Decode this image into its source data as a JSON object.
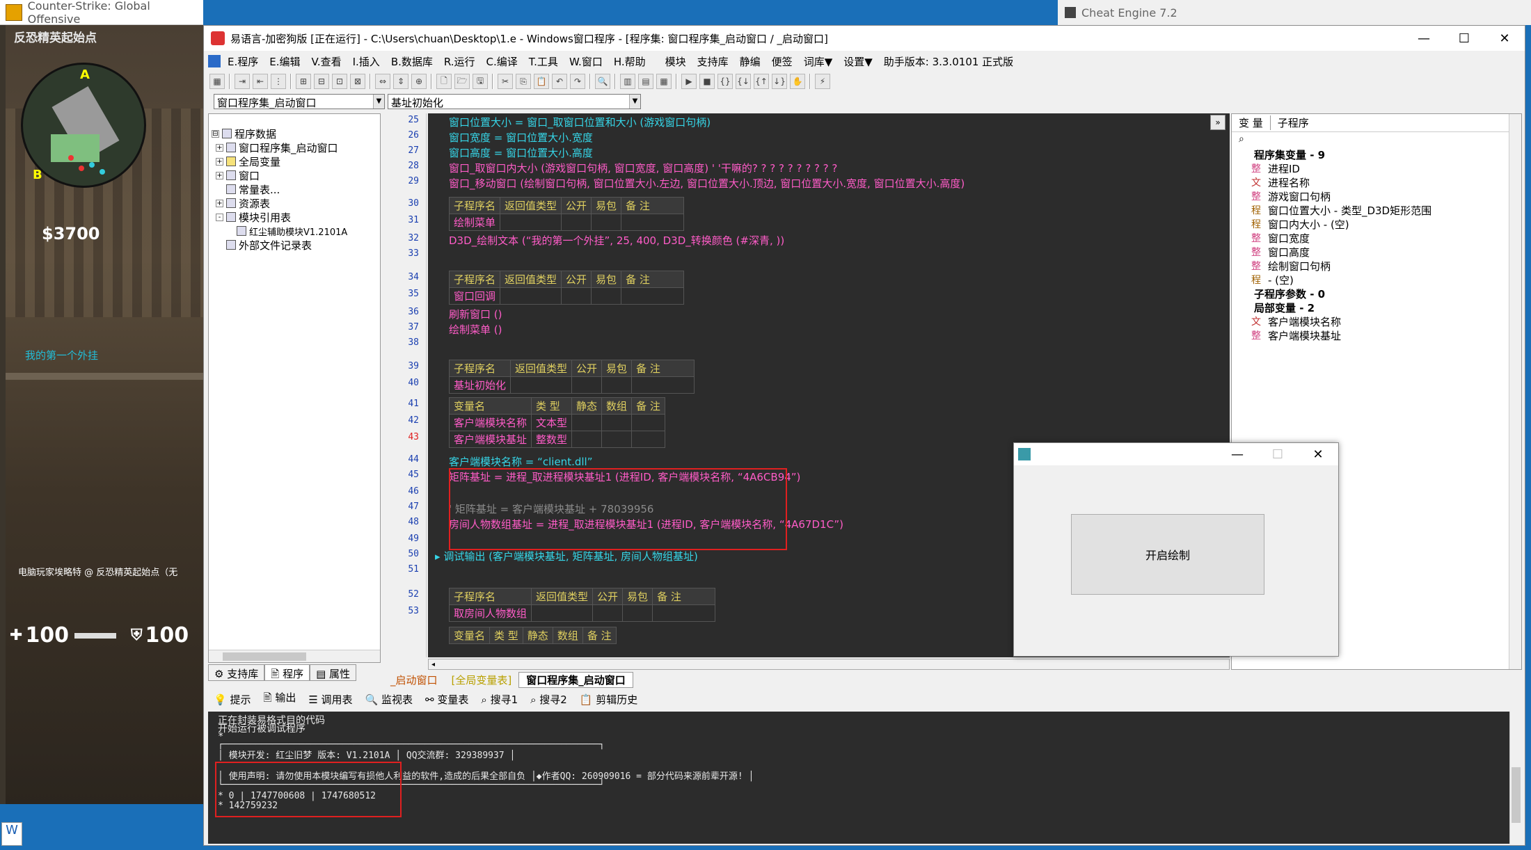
{
  "game": {
    "title": "Counter-Strike: Global Offensive",
    "location": "反恐精英起始点",
    "money": "$3700",
    "radar_label_a": "A",
    "radar_label_b": "B",
    "overlay_text": "我的第一个外挂",
    "chat": "电脑玩家埃略特 @ 反恐精英起始点（无",
    "health": "100",
    "armor": "100"
  },
  "cheat_engine": {
    "title": "Cheat Engine 7.2"
  },
  "ide": {
    "title": "易语言-加密狗版 [正在运行] - C:\\Users\\chuan\\Desktop\\1.e - Windows窗口程序 - [程序集: 窗口程序集_启动窗口 / _启动窗口]",
    "window_controls": {
      "min": "—",
      "max": "☐",
      "close": "✕"
    },
    "menu": [
      "E.程序",
      "E.编辑",
      "V.查看",
      "I.插入",
      "B.数据库",
      "R.运行",
      "C.编译",
      "T.工具",
      "W.窗口",
      "H.帮助",
      "模块",
      "支持库",
      "静编",
      "便签",
      "词库▼",
      "设置▼",
      "助手版本: 3.3.0101 正式版"
    ],
    "combo_left": "窗口程序集_启动窗口",
    "combo_right": "基址初始化",
    "tree": [
      {
        "label": "程序数据",
        "indent": 0,
        "pm": "⊟"
      },
      {
        "label": "窗口程序集_启动窗口",
        "indent": 1,
        "pm": "+"
      },
      {
        "label": "全局变量",
        "indent": 1,
        "pm": "+"
      },
      {
        "label": "窗口",
        "indent": 1,
        "pm": "+"
      },
      {
        "label": "常量表...",
        "indent": 1,
        "pm": ""
      },
      {
        "label": "资源表",
        "indent": 1,
        "pm": "+"
      },
      {
        "label": "模块引用表",
        "indent": 1,
        "pm": "-"
      },
      {
        "label": "红尘辅助模块V1.2101A",
        "indent": 2,
        "pm": ""
      },
      {
        "label": "外部文件记录表",
        "indent": 1,
        "pm": ""
      }
    ],
    "left_tabs": [
      "支持库",
      "程序",
      "属性"
    ],
    "line_numbers": [
      "25",
      "26",
      "27",
      "28",
      "29",
      "30",
      "31",
      "32",
      "33",
      "34",
      "35",
      "36",
      "37",
      "38",
      "39",
      "40",
      "41",
      "42",
      "43",
      "44",
      "45",
      "46",
      "47",
      "48",
      "49",
      "50",
      "51",
      "52",
      "53"
    ],
    "code": {
      "l25": "窗口位置大小 = 窗口_取窗口位置和大小 (游戏窗口句柄)",
      "l26": "窗口宽度 = 窗口位置大小.宽度",
      "l27": "窗口高度 = 窗口位置大小.高度",
      "l28": "窗口_取窗口内大小 (游戏窗口句柄, 窗口宽度, 窗口高度) ' '干嘛的? ? ? ? ? ? ? ? ? ?",
      "l29": "窗口_移动窗口 (绘制窗口句柄, 窗口位置大小.左边, 窗口位置大小.顶边, 窗口位置大小.宽度, 窗口位置大小.高度)",
      "t1_header": [
        "子程序名",
        "返回值类型",
        "公开",
        "易包",
        "备 注"
      ],
      "t1_row": [
        "绘制菜单",
        "",
        "",
        "",
        ""
      ],
      "l32": "D3D_绘制文本 (“我的第一个外挂”, 25, 400, D3D_转换颜色 (#深青, ))",
      "t2_header": [
        "子程序名",
        "返回值类型",
        "公开",
        "易包",
        "备 注"
      ],
      "t2_row": [
        "窗口回调",
        "",
        "",
        "",
        ""
      ],
      "l36": "刷新窗口 ()",
      "l37": "绘制菜单 ()",
      "t3_header": [
        "子程序名",
        "返回值类型",
        "公开",
        "易包",
        "备 注"
      ],
      "t3_row": [
        "基址初始化",
        "",
        "",
        "",
        ""
      ],
      "t4_header": [
        "变量名",
        "类 型",
        "静态",
        "数组",
        "备 注"
      ],
      "t4_rows": [
        [
          "客户端模块名称",
          "文本型",
          "",
          "",
          ""
        ],
        [
          "客户端模块基址",
          "整数型",
          "",
          "",
          ""
        ]
      ],
      "l44": "客户端模块名称 = “client.dll”",
      "l45": "矩阵基址 = 进程_取进程模块基址1 (进程ID, 客户端模块名称, “4A6CB94”)",
      "l47": "' 矩阵基址 = 客户端模块基址 + 78039956",
      "l48": "房间人物数组基址 = 进程_取进程模块基址1 (进程ID, 客户端模块名称, “4A67D1C”)",
      "l50": "调试输出 (客户端模块基址, 矩阵基址, 房间人物组基址)",
      "t5_header": [
        "子程序名",
        "返回值类型",
        "公开",
        "易包",
        "备 注"
      ],
      "t5_row": [
        "取房间人物数组",
        "",
        "",
        "",
        ""
      ],
      "t6_header": [
        "变量名",
        "类 型",
        "静态",
        "数组",
        "备 注"
      ]
    },
    "code_tabs": [
      "_启动窗口",
      "[全局变量表]",
      "窗口程序集_启动窗口"
    ],
    "right_tabs": [
      "变 量",
      "子程序"
    ],
    "right_tree": [
      {
        "tag": "",
        "label": "程序集变量 - 9",
        "bold": true,
        "indent": 0
      },
      {
        "tag": "整",
        "label": "进程ID",
        "indent": 1
      },
      {
        "tag": "文",
        "label": "进程名称",
        "indent": 1
      },
      {
        "tag": "整",
        "label": "游戏窗口句柄",
        "indent": 1
      },
      {
        "tag": "程",
        "label": "窗口位置大小 - 类型_D3D矩形范围",
        "indent": 1
      },
      {
        "tag": "程",
        "label": "窗口内大小 - (空)",
        "indent": 1
      },
      {
        "tag": "整",
        "label": "窗口宽度",
        "indent": 1
      },
      {
        "tag": "整",
        "label": "窗口高度",
        "indent": 1
      },
      {
        "tag": "整",
        "label": "绘制窗口句柄",
        "indent": 1
      },
      {
        "tag": "程",
        "label": "- (空)",
        "indent": 1
      },
      {
        "tag": "",
        "label": "子程序参数 - 0",
        "bold": true,
        "indent": 0
      },
      {
        "tag": "",
        "label": "局部变量 - 2",
        "bold": true,
        "indent": 0
      },
      {
        "tag": "文",
        "label": "客户端模块名称",
        "indent": 1
      },
      {
        "tag": "整",
        "label": "客户端模块基址",
        "indent": 1
      }
    ],
    "output_tabs": [
      "提示",
      "输出",
      "调用表",
      "监视表",
      "变量表",
      "搜寻1",
      "搜寻2",
      "剪辑历史"
    ],
    "output_lines": [
      "正在封装易格式目的代码",
      "开始运行被调试程序",
      "*",
      "┌─────────────────────────────────────────────────────────────────────┐",
      "│ 模块开发: 红尘旧梦    版本: V1.2101A          │              QQ交流群: 329389937       │",
      "│ 使用声明: 请勿使用本模块编写有损他人利益的软件,造成的后果全部自负 │◆作者QQ: 260909016  = 部分代码来源前辈开源! │",
      "└─────────────────────────────────────────────────────────────────────┘",
      "* 0 | 1747700608 | 1747680512",
      "* 142759232"
    ]
  },
  "dialog": {
    "button": "开启绘制",
    "controls": {
      "min": "—",
      "max": "☐",
      "close": "✕"
    }
  },
  "colors": {
    "code_bg": "#2c2c2c",
    "cyan": "#36d6e8",
    "pink": "#ff5cc8",
    "green": "#3fd060",
    "gray": "#8a8a8a",
    "red_box": "#e02020"
  }
}
